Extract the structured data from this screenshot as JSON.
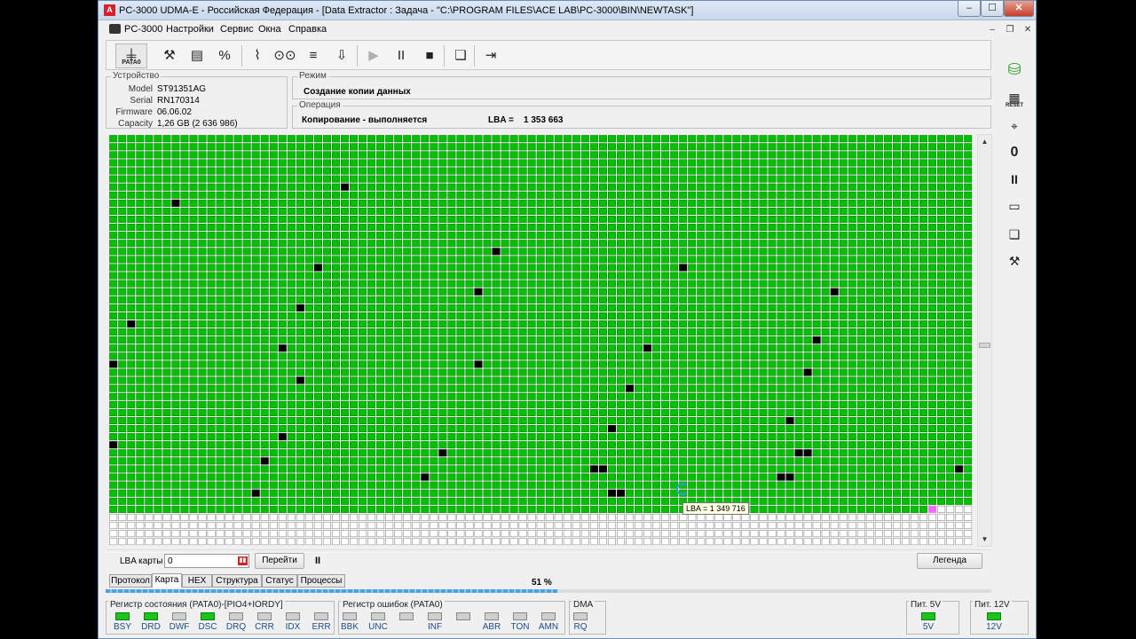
{
  "window": {
    "title": "PC-3000 UDMA-E - Российская Федерация - [Data Extractor : Задача - \"C:\\PROGRAM FILES\\ACE LAB\\PC-3000\\BIN\\NEWTASK\"]",
    "app_icon": "А",
    "controls": {
      "minimize": "–",
      "maximize": "☐",
      "close": "✕"
    }
  },
  "menu": {
    "items": [
      "PC-3000",
      "Настройки",
      "Сервис",
      "Окна",
      "Справка"
    ],
    "mdi": {
      "minimize": "–",
      "restore": "❐",
      "close": "✕"
    }
  },
  "toolbar": {
    "pata_label": "PATA0",
    "icons": {
      "pata": "pata-icon",
      "tools": "tools-icon",
      "sector_editor": "sector-editor-icon",
      "percent": "percent-icon",
      "probe": "probe-icon",
      "binoculars": "binoculars-icon",
      "drive_stack": "drive-stack-icon",
      "disk_arrow": "disk-arrow-icon",
      "play": "play-icon",
      "pause": "pause-icon",
      "stop": "stop-icon",
      "windows": "windows-icon",
      "exit": "exit-icon"
    },
    "glyphs": {
      "pata": "╪",
      "tools": "⚒",
      "sector_editor": "▤",
      "percent": "%",
      "probe": "⌇",
      "binoculars": "⊙⊙",
      "drive_stack": "≡",
      "disk_arrow": "⇩",
      "play": "▶",
      "pause": "II",
      "stop": "■",
      "windows": "❏",
      "exit": "⇥"
    }
  },
  "device": {
    "legend": "Устройство",
    "model_label": "Model",
    "model": "ST91351AG",
    "serial_label": "Serial",
    "serial": "RN170314",
    "firmware_label": "Firmware",
    "firmware": "06.06.02",
    "capacity_label": "Capacity",
    "capacity": "1,26 GB (2 636 986)"
  },
  "mode": {
    "legend": "Режим",
    "value": "Создание копии данных"
  },
  "operation": {
    "legend": "Операция",
    "status": "Копирование - выполняется",
    "lba_label": "LBA =",
    "lba_value": "1 353 663"
  },
  "map": {
    "columns": 97,
    "rows": 51,
    "filled_rows": 47,
    "filled_cols_last_row": 92,
    "colors": {
      "ok": "#00c000",
      "cell_border": "#0a7a0a",
      "bad": "#000000",
      "empty": "#ffffff",
      "empty_border": "#8a8a8a",
      "current": "#ff66ff"
    },
    "bad_cells": [
      [
        6,
        26
      ],
      [
        8,
        7
      ],
      [
        14,
        43
      ],
      [
        16,
        23
      ],
      [
        16,
        64
      ],
      [
        19,
        41
      ],
      [
        19,
        81
      ],
      [
        21,
        21
      ],
      [
        23,
        2
      ],
      [
        25,
        79
      ],
      [
        26,
        19
      ],
      [
        26,
        60
      ],
      [
        28,
        0
      ],
      [
        28,
        41
      ],
      [
        29,
        78
      ],
      [
        30,
        21
      ],
      [
        31,
        58
      ],
      [
        35,
        76
      ],
      [
        36,
        56
      ],
      [
        37,
        19
      ],
      [
        38,
        0
      ],
      [
        39,
        37
      ],
      [
        39,
        77
      ],
      [
        39,
        78
      ],
      [
        40,
        17
      ],
      [
        41,
        54
      ],
      [
        41,
        55
      ],
      [
        41,
        95
      ],
      [
        42,
        35
      ],
      [
        42,
        75
      ],
      [
        42,
        76
      ],
      [
        44,
        16
      ],
      [
        44,
        56
      ],
      [
        44,
        57
      ]
    ],
    "current_cell": [
      46,
      92
    ],
    "tooltip": "LBA =  1 349 716"
  },
  "nav": {
    "lba_map_label": "LBA карты",
    "lba_input_value": "0",
    "goto_label": "Перейти",
    "pause_label": "II",
    "legend_label": "Легенда"
  },
  "tabs": [
    "Протокол",
    "Карта",
    "HEX",
    "Структура",
    "Статус",
    "Процессы"
  ],
  "progress": {
    "percent": 51,
    "label": "51 %"
  },
  "registers": {
    "status": {
      "title": "Регистр состояния (PATA0)-[PIO4+IORDY]",
      "leds": [
        {
          "label": "BSY",
          "on": true
        },
        {
          "label": "DRD",
          "on": true
        },
        {
          "label": "DWF",
          "on": false
        },
        {
          "label": "DSC",
          "on": true
        },
        {
          "label": "DRQ",
          "on": false
        },
        {
          "label": "CRR",
          "on": false
        },
        {
          "label": "IDX",
          "on": false
        },
        {
          "label": "ERR",
          "on": false
        }
      ]
    },
    "errors": {
      "title": "Регистр ошибок (PATA0)",
      "leds": [
        {
          "label": "BBK",
          "on": false
        },
        {
          "label": "UNC",
          "on": false
        },
        {
          "label": "",
          "on": false
        },
        {
          "label": "INF",
          "on": false
        },
        {
          "label": "",
          "on": false
        },
        {
          "label": "ABR",
          "on": false
        },
        {
          "label": "TON",
          "on": false
        },
        {
          "label": "AMN",
          "on": false
        }
      ]
    },
    "dma": {
      "title": "DMA",
      "leds": [
        {
          "label": "RQ",
          "on": false
        }
      ]
    },
    "power5": {
      "title": "Пит. 5V",
      "leds": [
        {
          "label": "5V",
          "on": true
        }
      ]
    },
    "power12": {
      "title": "Пит. 12V",
      "leds": [
        {
          "label": "12V",
          "on": true
        }
      ]
    }
  },
  "side": {
    "icons": [
      "database-icon",
      "reset-icon",
      "probe-icon",
      "zero-icon",
      "pause-icon",
      "hdd-icon",
      "copy-icon",
      "tools-icon"
    ],
    "glyphs": {
      "database": "⛁",
      "reset": "▦",
      "probe": "⌖",
      "zero": "0",
      "pause": "II",
      "hdd": "▭",
      "copy": "❏",
      "tools": "⚒"
    },
    "reset_label": "RESET"
  }
}
